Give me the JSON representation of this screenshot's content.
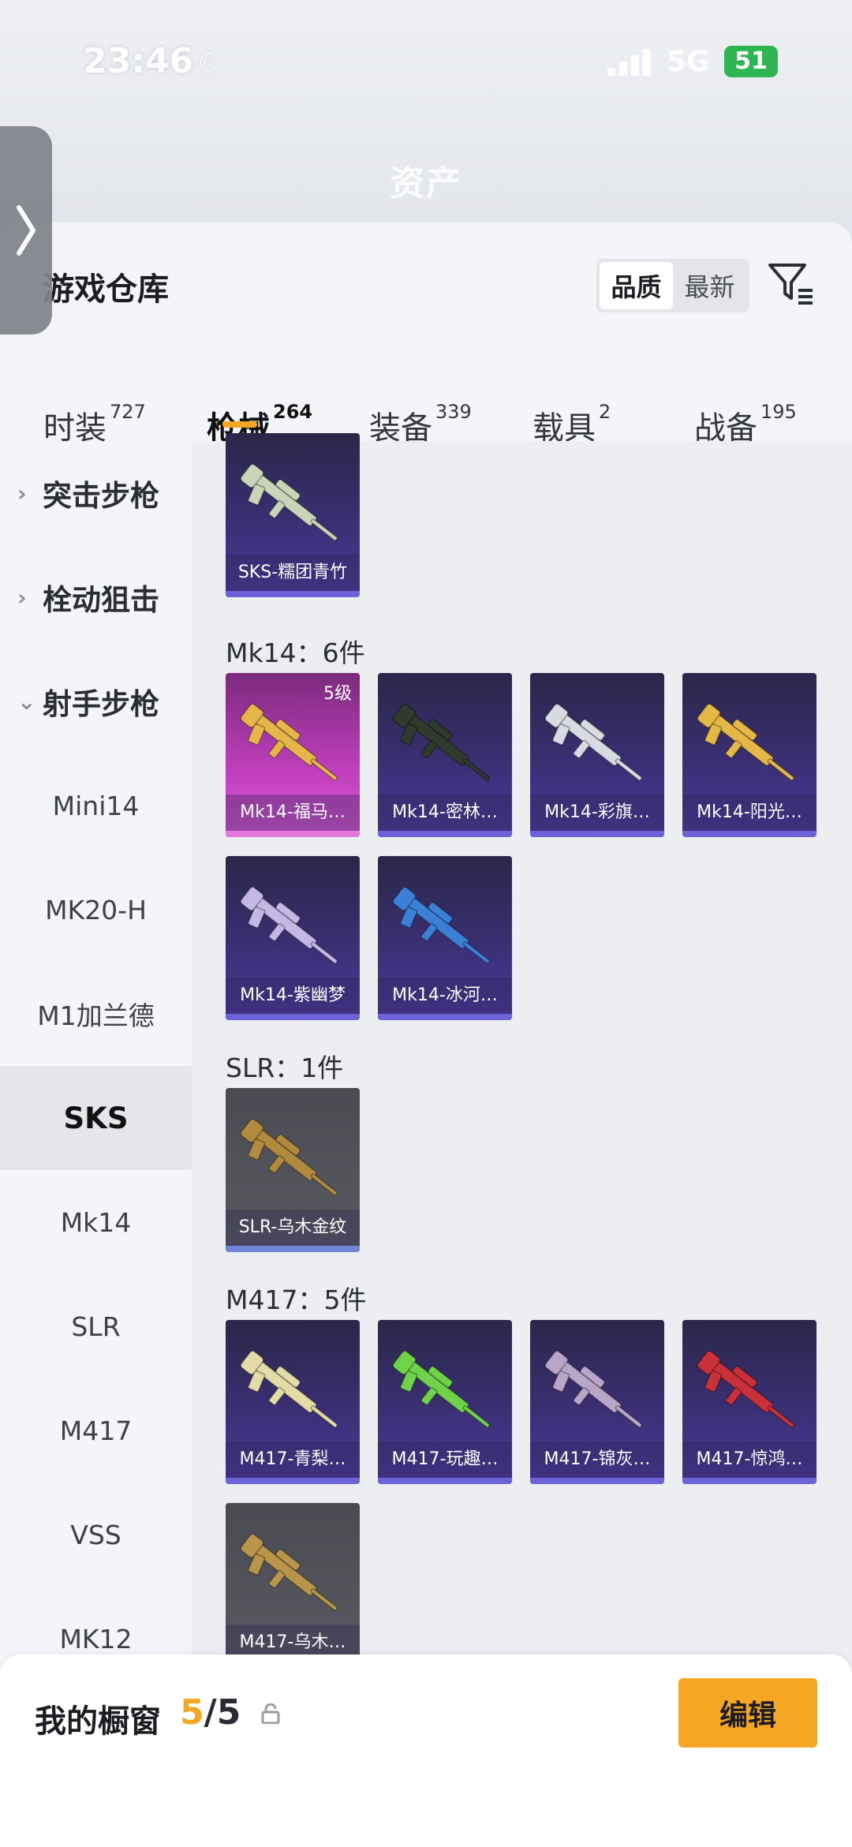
{
  "status": {
    "time": "23:46",
    "network": "5G",
    "battery": "51"
  },
  "header": {
    "page_title": "资产"
  },
  "panel": {
    "title": "游戏仓库",
    "sort": {
      "options": [
        "品质",
        "最新"
      ],
      "selected": "品质"
    }
  },
  "tabs": [
    {
      "label": "时装",
      "count": "727"
    },
    {
      "label": "枪械",
      "count": "264",
      "active": true
    },
    {
      "label": "装备",
      "count": "339"
    },
    {
      "label": "载具",
      "count": "2"
    },
    {
      "label": "战备",
      "count": "195"
    }
  ],
  "categories": [
    {
      "label": "突击步枪",
      "type": "group",
      "expanded": false
    },
    {
      "label": "栓动狙击",
      "type": "group",
      "expanded": false
    },
    {
      "label": "射手步枪",
      "type": "group",
      "expanded": true
    },
    {
      "label": "Mini14",
      "type": "sub"
    },
    {
      "label": "MK20-H",
      "type": "sub"
    },
    {
      "label": "M1加兰德",
      "type": "sub"
    },
    {
      "label": "SKS",
      "type": "sub",
      "selected": true
    },
    {
      "label": "Mk14",
      "type": "sub"
    },
    {
      "label": "SLR",
      "type": "sub"
    },
    {
      "label": "M417",
      "type": "sub"
    },
    {
      "label": "VSS",
      "type": "sub"
    },
    {
      "label": "MK12",
      "type": "sub"
    }
  ],
  "sections": [
    {
      "label": "",
      "items": [
        {
          "name": "SKS-糯团青竹",
          "rarity": "purple",
          "color": "#c9d4b8"
        }
      ]
    },
    {
      "label": "Mk14：6件",
      "items": [
        {
          "name": "Mk14-福马…",
          "rarity": "pink",
          "level": "5级",
          "color": "#e7b64a"
        },
        {
          "name": "Mk14-密林…",
          "rarity": "purple",
          "color": "#2f3a2c"
        },
        {
          "name": "Mk14-彩旗…",
          "rarity": "purple",
          "color": "#d9dbe3"
        },
        {
          "name": "Mk14-阳光…",
          "rarity": "purple",
          "color": "#e5b746"
        },
        {
          "name": "Mk14-紫幽梦",
          "rarity": "purple",
          "color": "#c5b8e6"
        },
        {
          "name": "Mk14-冰河…",
          "rarity": "purple",
          "color": "#3b7fd6"
        }
      ]
    },
    {
      "label": "SLR：1件",
      "items": [
        {
          "name": "SLR-乌木金纹",
          "rarity": "gray",
          "color": "#b08a3e"
        }
      ]
    },
    {
      "label": "M417：5件",
      "items": [
        {
          "name": "M417-青梨…",
          "rarity": "purple",
          "color": "#e4dca6"
        },
        {
          "name": "M417-玩趣…",
          "rarity": "purple",
          "color": "#6fd24a"
        },
        {
          "name": "M417-锦灰…",
          "rarity": "purple",
          "color": "#b8a6c8"
        },
        {
          "name": "M417-惊鸿…",
          "rarity": "purple",
          "color": "#c9303a"
        },
        {
          "name": "M417-乌木…",
          "rarity": "gray",
          "color": "#b8954a"
        }
      ]
    }
  ],
  "bottom": {
    "title": "我的橱窗",
    "current": "5",
    "total": "/5",
    "edit_label": "编辑"
  },
  "colors": {
    "accent": "#f5a623",
    "purple_bar": "#6d62d8",
    "pink_bar": "#e37ad9"
  }
}
